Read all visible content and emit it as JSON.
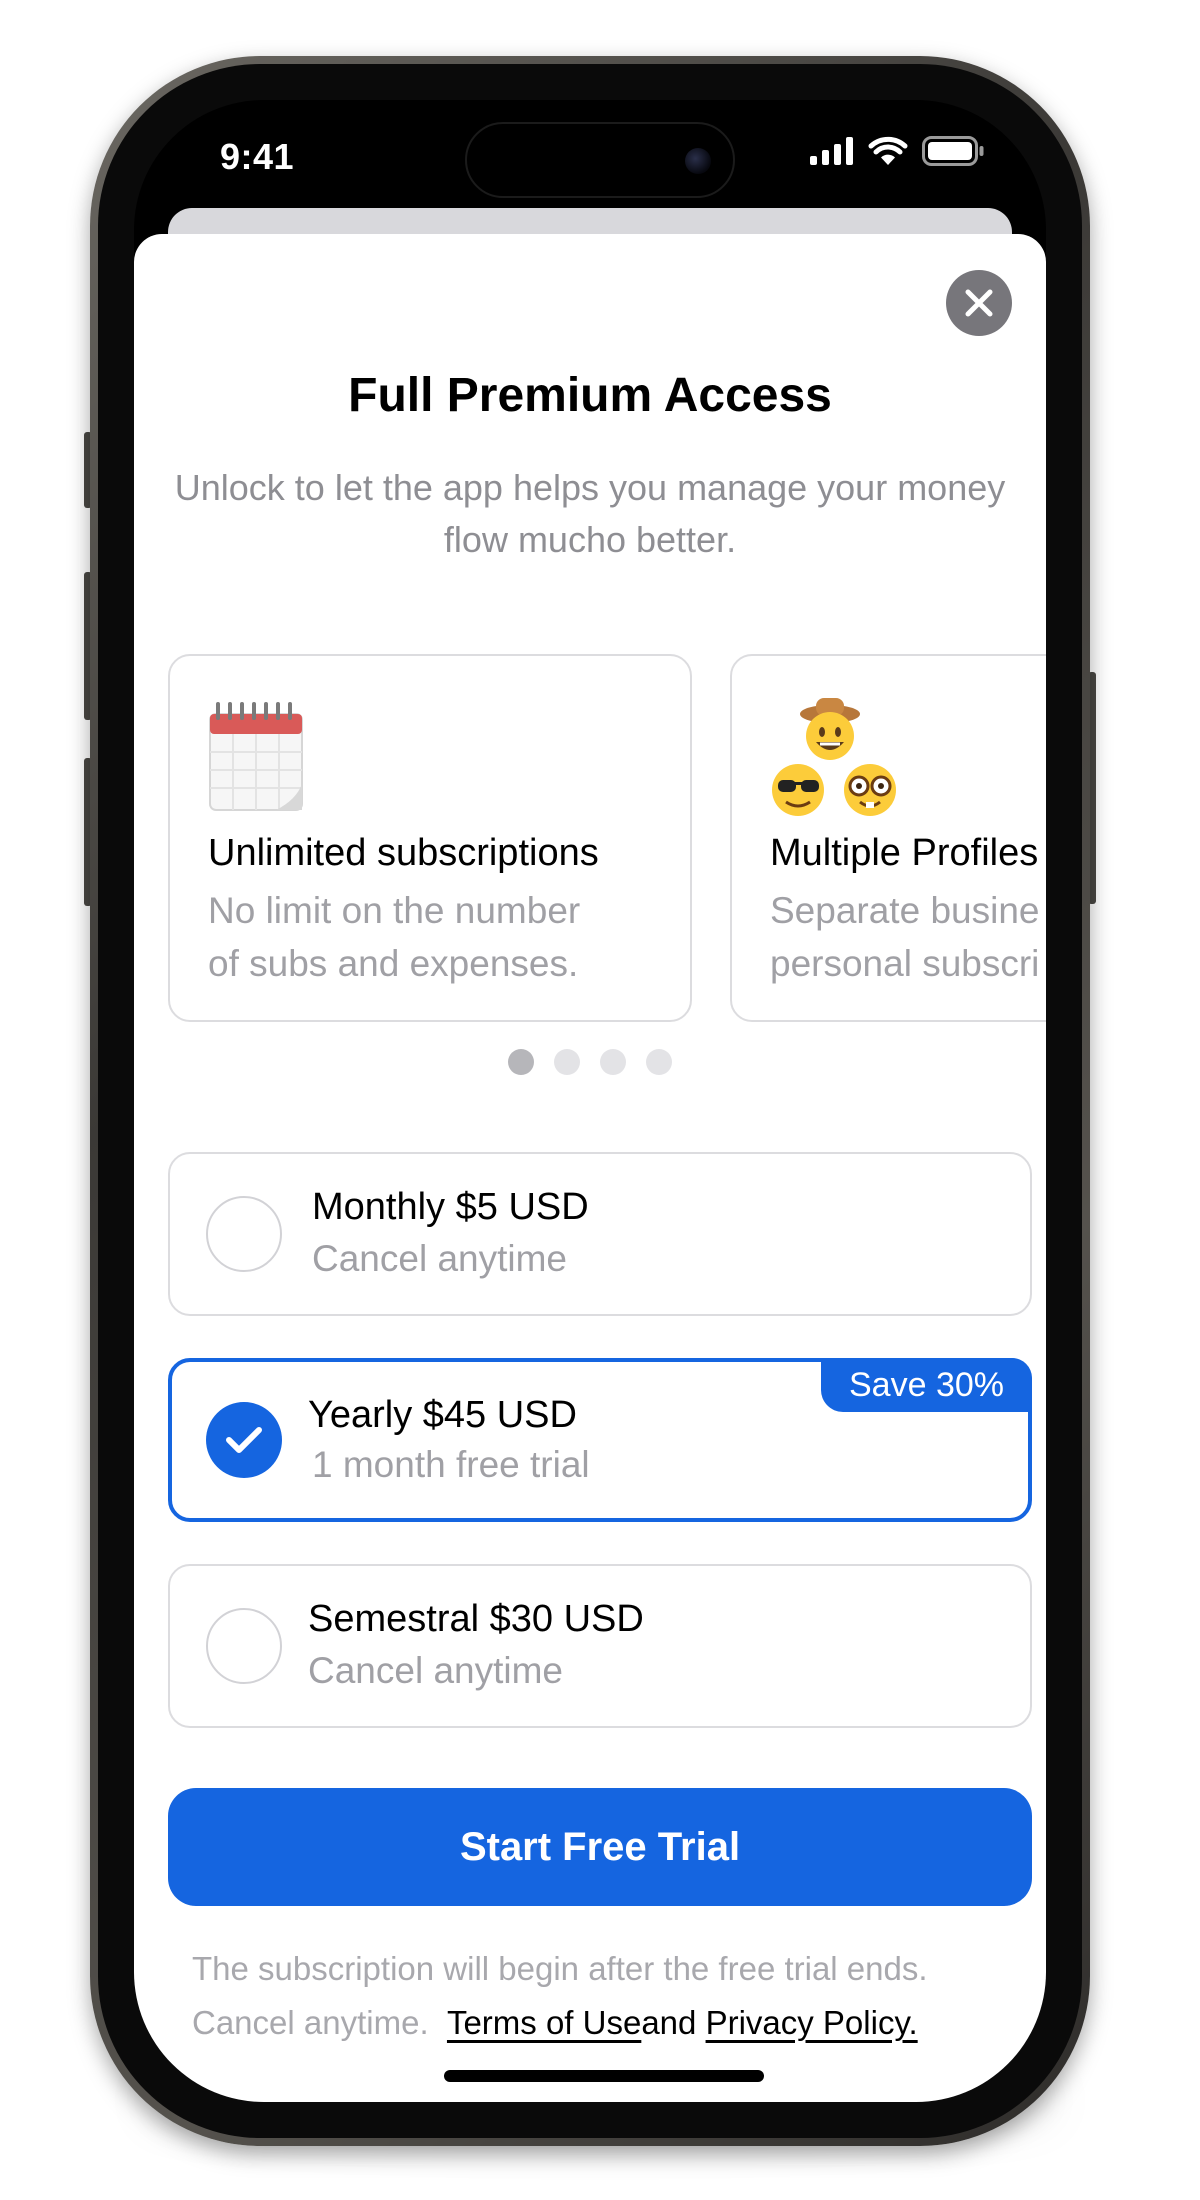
{
  "status_bar": {
    "time": "9:41"
  },
  "paywall": {
    "title": "Full Premium Access",
    "subtitle": "Unlock to let the app helps you manage your money flow mucho better.",
    "features": [
      {
        "icon": "calendar-icon",
        "title": "Unlimited subscriptions",
        "description_line1": "No limit on the number",
        "description_line2": "of subs and expenses."
      },
      {
        "icon": "faces-icon",
        "title": "Multiple Profiles",
        "description_line1": "Separate busine",
        "description_line2": "personal subscri"
      }
    ],
    "carousel": {
      "page_count": 4,
      "active_page": 1
    },
    "plans": [
      {
        "name": "Monthly $5 USD",
        "detail": "Cancel anytime",
        "selected": false
      },
      {
        "name": "Yearly $45 USD",
        "detail": "1 month free trial",
        "selected": true,
        "badge": "Save 30%"
      },
      {
        "name": "Semestral $30 USD",
        "detail": "Cancel anytime",
        "selected": false
      }
    ],
    "cta_label": "Start Free Trial",
    "footer": {
      "line1": "The subscription will begin after the free trial ends.",
      "line2_prefix": "Cancel anytime.",
      "terms_link": "Terms of Use",
      "conjunction": "and",
      "privacy_link": "Privacy Policy."
    }
  },
  "colors": {
    "accent": "#1565e0",
    "secondary_text": "#a0a0a5",
    "close_button": "#77767b"
  }
}
